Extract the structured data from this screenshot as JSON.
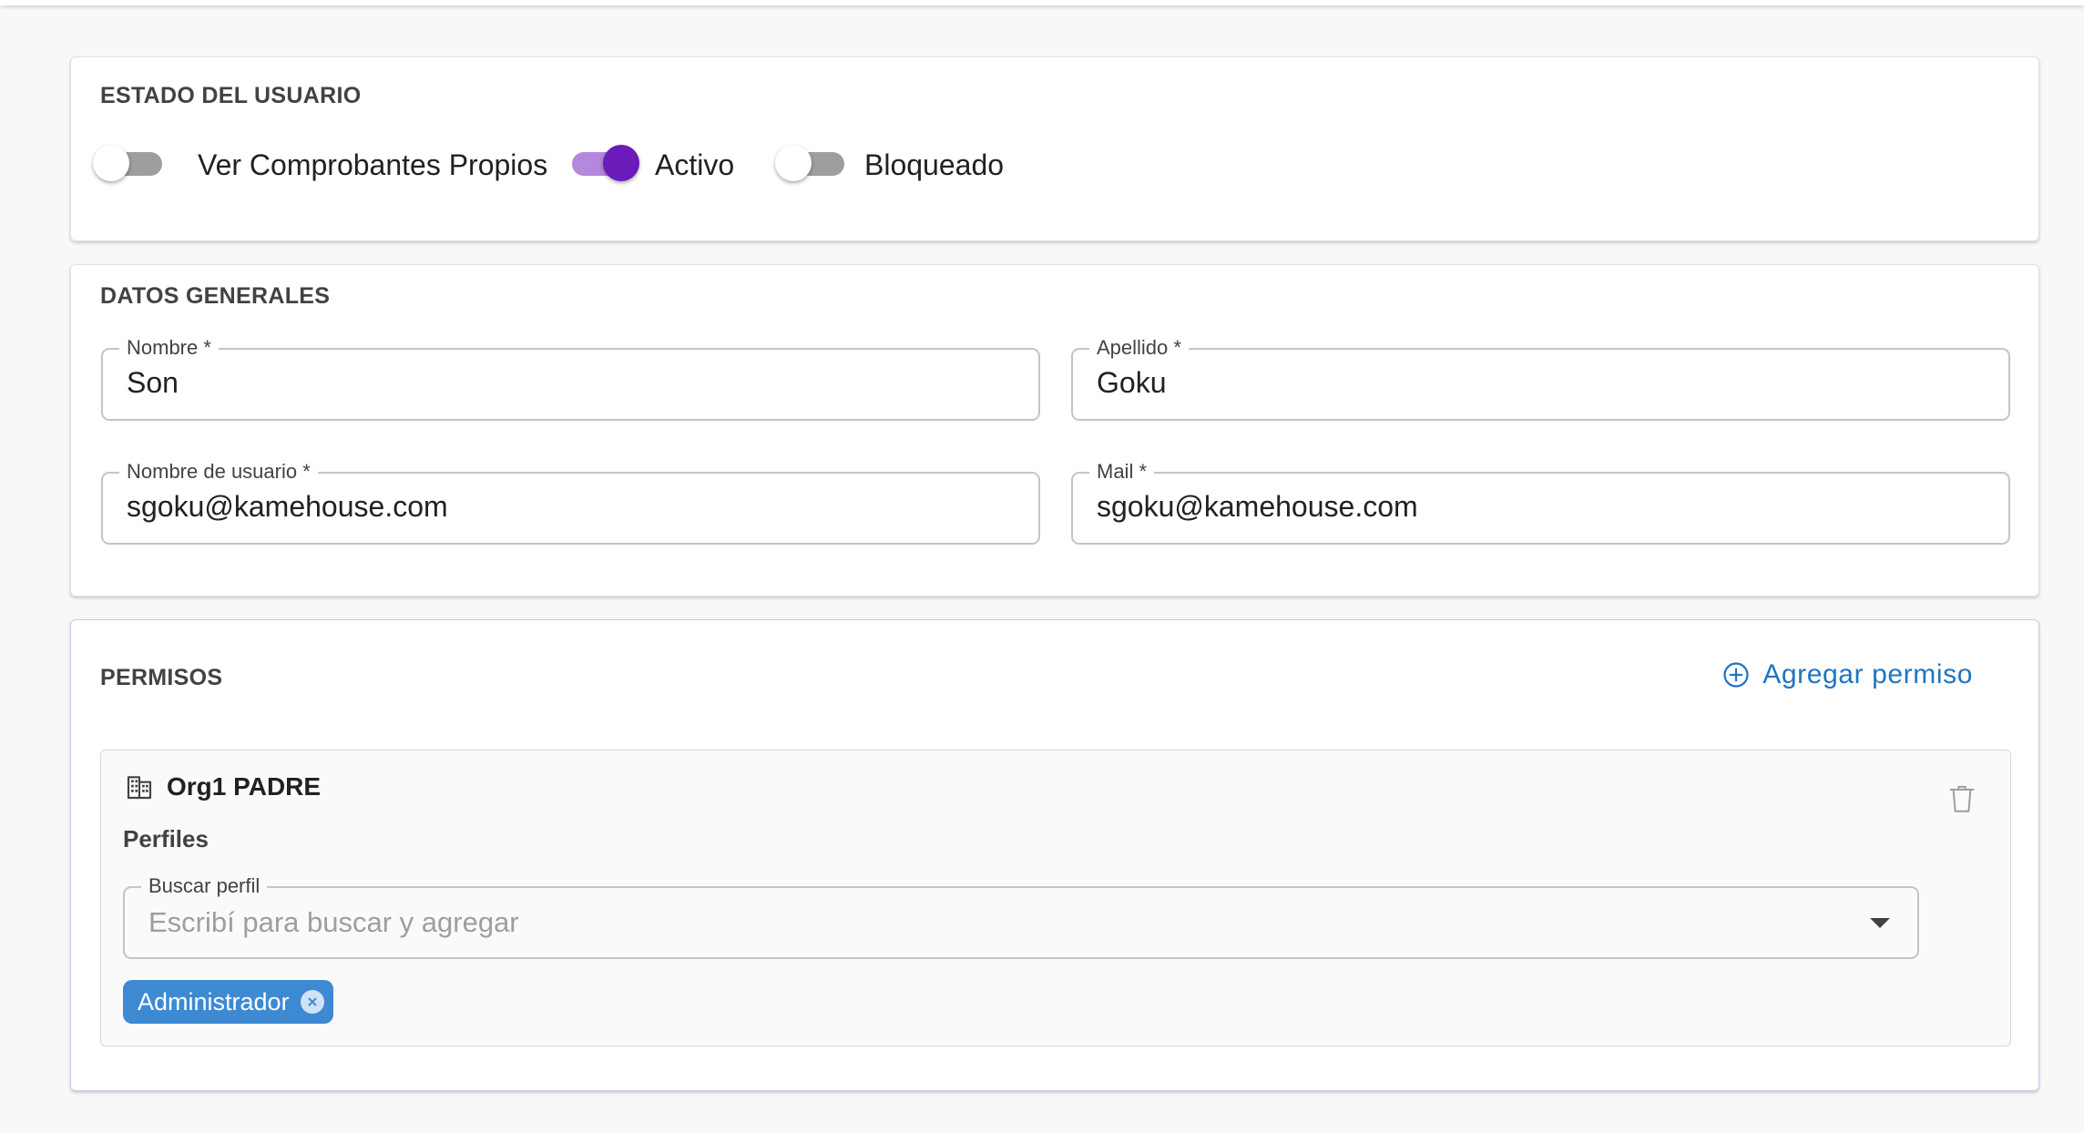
{
  "estado": {
    "title": "ESTADO DEL USUARIO",
    "switches": [
      {
        "label": "Ver Comprobantes Propios",
        "checked": false
      },
      {
        "label": "Activo",
        "checked": true
      },
      {
        "label": "Bloqueado",
        "checked": false
      }
    ]
  },
  "datos": {
    "title": "DATOS GENERALES",
    "nombre": {
      "label": "Nombre *",
      "value": "Son"
    },
    "apellido": {
      "label": "Apellido *",
      "value": "Goku"
    },
    "usuario": {
      "label": "Nombre de usuario *",
      "value": "sgoku@kamehouse.com"
    },
    "mail": {
      "label": "Mail *",
      "value": "sgoku@kamehouse.com"
    }
  },
  "permisos": {
    "title": "PERMISOS",
    "add_label": "Agregar permiso",
    "org": {
      "name": "Org1 PADRE",
      "perfiles_label": "Perfiles",
      "search": {
        "label": "Buscar perfil",
        "placeholder": "Escribí para buscar y agregar",
        "value": ""
      },
      "chips": [
        {
          "label": "Administrador"
        }
      ]
    }
  },
  "colors": {
    "accent": "#6a1bb9",
    "link": "#1f74c4",
    "chip": "#3d8ad2"
  },
  "icons": {
    "org": "building-icon",
    "add": "plus-circle-icon",
    "delete": "trash-icon",
    "dropdown": "caret-down-icon",
    "chip_remove": "close-circle-icon"
  }
}
